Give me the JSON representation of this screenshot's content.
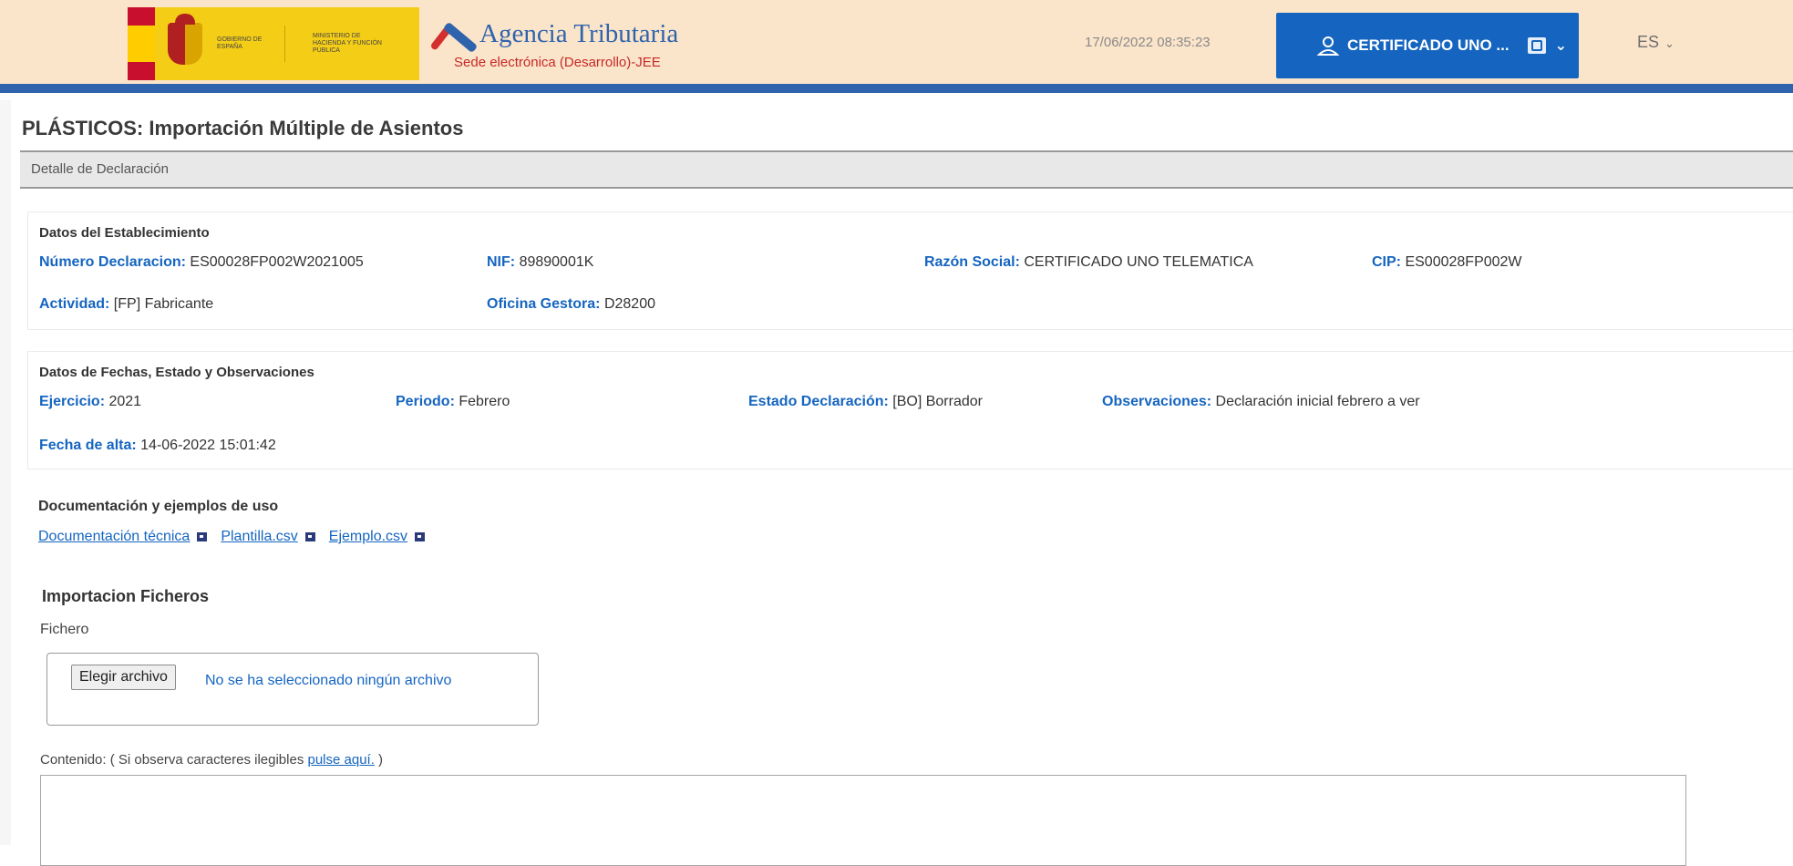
{
  "header": {
    "gov_logo_text_1": "Gobierno de España",
    "gov_logo_text_2": "Ministerio de Hacienda y Función Pública",
    "agency_name": "Agencia Tributaria",
    "agency_subtitle": "Sede electrónica (Desarrollo)-JEE",
    "datetime": "17/06/2022 08:35:23",
    "user_label": "CERTIFICADO UNO ...",
    "language": "ES",
    "colors": {
      "background": "#fbe5ca",
      "accent": "#2f64ad",
      "user_button": "#1565c0"
    }
  },
  "page": {
    "title": "PLÁSTICOS: Importación Múltiple de Asientos",
    "section_bar": "Detalle de Declaración"
  },
  "establecimiento": {
    "title": "Datos del Establecimiento",
    "numero_declaracion_label": "Número Declaracion:",
    "numero_declaracion_value": "ES00028FP002W2021005",
    "nif_label": "NIF:",
    "nif_value": "89890001K",
    "razon_social_label": "Razón Social:",
    "razon_social_value": "CERTIFICADO UNO TELEMATICA",
    "cip_label": "CIP:",
    "cip_value": "ES00028FP002W",
    "actividad_label": "Actividad:",
    "actividad_value": "[FP] Fabricante",
    "oficina_label": "Oficina Gestora:",
    "oficina_value": "D28200"
  },
  "fechas": {
    "title": "Datos de Fechas, Estado y Observaciones",
    "ejercicio_label": "Ejercicio:",
    "ejercicio_value": "2021",
    "periodo_label": "Periodo:",
    "periodo_value": "Febrero",
    "estado_label": "Estado Declaración:",
    "estado_value": "[BO] Borrador",
    "observaciones_label": "Observaciones:",
    "observaciones_value": "Declaración inicial febrero a ver",
    "fecha_alta_label": "Fecha de alta:",
    "fecha_alta_value": "14-06-2022 15:01:42"
  },
  "documentacion": {
    "title": "Documentación y ejemplos de uso",
    "links": [
      "Documentación técnica",
      "Plantilla.csv",
      "Ejemplo.csv"
    ]
  },
  "importacion": {
    "title": "Importacion Ficheros",
    "fichero_label": "Fichero",
    "choose_button": "Elegir archivo",
    "no_file_text": "No se ha seleccionado ningún archivo",
    "contenido_prefix": "Contenido: ( Si observa caracteres ilegibles ",
    "contenido_link": "pulse aquí.",
    "contenido_suffix": " )"
  }
}
